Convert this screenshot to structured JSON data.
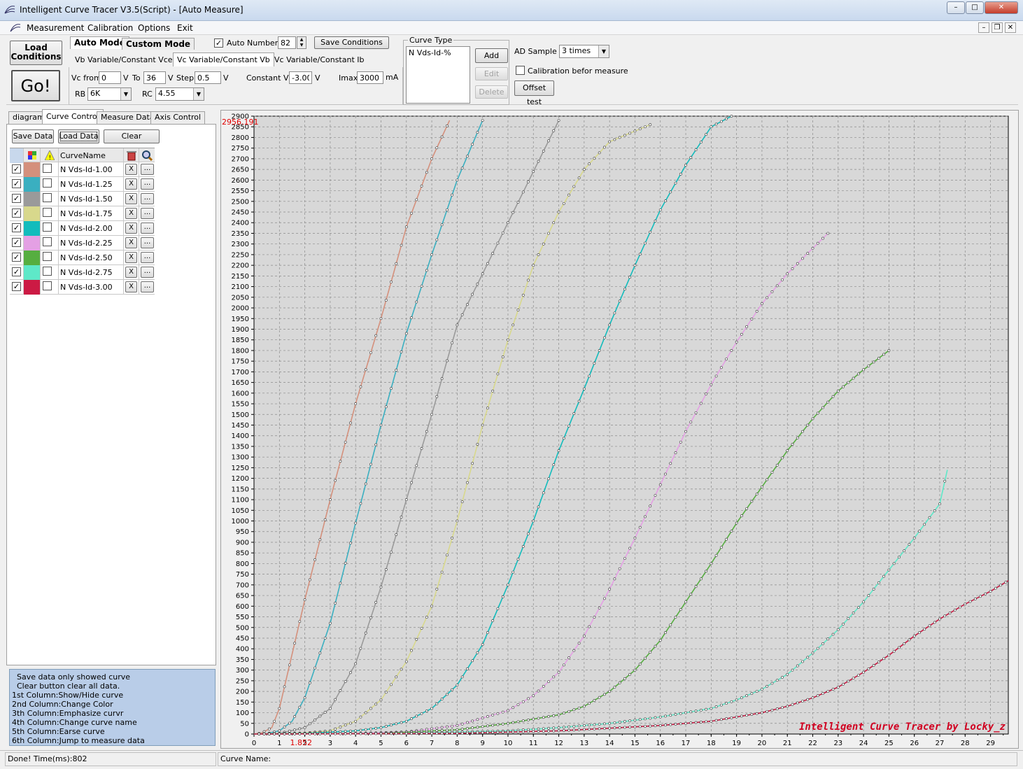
{
  "window": {
    "title": "Intelligent Curve Tracer V3.5(Script) - [Auto Measure]"
  },
  "menu": [
    "Measurement",
    "Calibration",
    "Options",
    "Exit"
  ],
  "toolbar": {
    "load_conditions": "Load Conditions",
    "go": "Go!",
    "auto_mode": "Auto Mode",
    "custom_mode": "Custom Mode",
    "auto_number_label": "Auto Number",
    "auto_number_checked": true,
    "auto_number_value": "82",
    "save_conditions": "Save Conditions",
    "mode_tabs": [
      "Vb Variable/Constant Vce",
      "Vc Variable/Constant Vb",
      "Vc Variable/Constant Ib"
    ],
    "vc_from_label": "Vc from",
    "vc_from": "0",
    "v1": "V",
    "to_label": "To",
    "to": "36",
    "v2": "V",
    "step_label": "Step",
    "step": "0.5",
    "v3": "V",
    "constant_vb_label": "Constant Vb",
    "constant_vb": "-3.00",
    "v4": "V",
    "imax_label": "Imax",
    "imax": "3000",
    "ma": "mA",
    "rb_label": "RB",
    "rb": "6K",
    "rc_label": "RC",
    "rc": "4.55",
    "curve_type_label": "Curve Type",
    "curve_type_item": "N Vds-Id-%",
    "add": "Add",
    "edit": "Edit",
    "delete": "Delete",
    "ad_sample_label": "AD Sample",
    "ad_sample": "3 times",
    "calibration_label": "Calibration befor measure",
    "offset_test": "Offset test"
  },
  "left_tabs": [
    "diagram",
    "Curve Control",
    "Measure Data",
    "Axis Control"
  ],
  "left_buttons": {
    "save_data": "Save Data",
    "load_data": "Load Data",
    "clear": "Clear"
  },
  "curve_table": {
    "header": "CurveName",
    "rows": [
      {
        "name": "N Vds-Id-1.00",
        "color": "#d4907c"
      },
      {
        "name": "N Vds-Id-1.25",
        "color": "#3aafc0"
      },
      {
        "name": "N Vds-Id-1.50",
        "color": "#9a9a9a"
      },
      {
        "name": "N Vds-Id-1.75",
        "color": "#d8d88c"
      },
      {
        "name": "N Vds-Id-2.00",
        "color": "#12bcbc"
      },
      {
        "name": "N Vds-Id-2.25",
        "color": "#e4a0e4"
      },
      {
        "name": "N Vds-Id-2.50",
        "color": "#56ae40"
      },
      {
        "name": "N Vds-Id-2.75",
        "color": "#5ee8c8"
      },
      {
        "name": "N Vds-Id-3.00",
        "color": "#cc1a44"
      }
    ],
    "erase": "X",
    "jump": "..."
  },
  "help_lines": [
    "  Save data only showed curve",
    "  Clear button clear all data.",
    "1st Column:Show/Hide curve",
    "2nd Column:Change Color",
    "3th Column:Emphasize curvr",
    "4th Column:Change curve name",
    "5th Column:Earse curve",
    "6th Column:Jump to measure data"
  ],
  "status": {
    "left": "Done!  Time(ms):802",
    "right": "Curve Name:"
  },
  "chart_data": {
    "type": "line",
    "xlim": [
      0,
      29.7
    ],
    "ylim": [
      0,
      2900
    ],
    "x_ticks": [
      0,
      1,
      2,
      3,
      4,
      5,
      6,
      7,
      8,
      9,
      10,
      11,
      12,
      13,
      14,
      15,
      16,
      17,
      18,
      19,
      20,
      21,
      22,
      23,
      24,
      25,
      26,
      27,
      28,
      29
    ],
    "y_step": 50,
    "grid": true,
    "cursor_y_label": "2956.191",
    "cursor_x_label": "1.852",
    "watermark": "Intelligent Curve Tracer by Locky_z",
    "series": [
      {
        "color": "#d4907c",
        "points": [
          [
            0,
            0
          ],
          [
            0.3,
            5
          ],
          [
            0.7,
            30
          ],
          [
            1,
            120
          ],
          [
            2,
            630
          ],
          [
            3,
            1100
          ],
          [
            4,
            1550
          ],
          [
            5,
            1950
          ],
          [
            6,
            2380
          ],
          [
            7,
            2700
          ],
          [
            7.7,
            2880
          ]
        ]
      },
      {
        "color": "#3aafc0",
        "points": [
          [
            0,
            0
          ],
          [
            0.5,
            2
          ],
          [
            1,
            15
          ],
          [
            1.5,
            60
          ],
          [
            2,
            170
          ],
          [
            3,
            520
          ],
          [
            4,
            990
          ],
          [
            5,
            1450
          ],
          [
            6,
            1880
          ],
          [
            7,
            2250
          ],
          [
            8,
            2600
          ],
          [
            9,
            2880
          ]
        ]
      },
      {
        "color": "#9a9a9a",
        "points": [
          [
            0,
            0
          ],
          [
            1,
            3
          ],
          [
            2,
            30
          ],
          [
            3,
            120
          ],
          [
            4,
            330
          ],
          [
            5,
            690
          ],
          [
            6,
            1100
          ],
          [
            7,
            1500
          ],
          [
            8,
            1920
          ],
          [
            10,
            2400
          ],
          [
            12,
            2880
          ]
        ]
      },
      {
        "color": "#d8d88c",
        "points": [
          [
            0,
            0
          ],
          [
            2,
            5
          ],
          [
            3,
            15
          ],
          [
            4,
            60
          ],
          [
            5,
            160
          ],
          [
            6,
            340
          ],
          [
            7,
            600
          ],
          [
            8,
            1000
          ],
          [
            9,
            1450
          ],
          [
            10,
            1850
          ],
          [
            11,
            2200
          ],
          [
            12,
            2450
          ],
          [
            13,
            2650
          ],
          [
            14,
            2780
          ],
          [
            15.6,
            2860
          ]
        ]
      },
      {
        "color": "#12bcbc",
        "points": [
          [
            0,
            0
          ],
          [
            2,
            3
          ],
          [
            4,
            15
          ],
          [
            5,
            30
          ],
          [
            6,
            60
          ],
          [
            7,
            120
          ],
          [
            8,
            230
          ],
          [
            9,
            420
          ],
          [
            10,
            700
          ],
          [
            11,
            1000
          ],
          [
            12,
            1330
          ],
          [
            13,
            1620
          ],
          [
            14,
            1920
          ],
          [
            15,
            2200
          ],
          [
            16,
            2460
          ],
          [
            17,
            2670
          ],
          [
            18,
            2850
          ],
          [
            18.8,
            2900
          ]
        ]
      },
      {
        "color": "#e4a0e4",
        "points": [
          [
            0,
            0
          ],
          [
            4,
            3
          ],
          [
            6,
            10
          ],
          [
            8,
            40
          ],
          [
            10,
            110
          ],
          [
            11,
            180
          ],
          [
            12,
            290
          ],
          [
            13,
            460
          ],
          [
            14,
            680
          ],
          [
            15,
            920
          ],
          [
            16,
            1170
          ],
          [
            17,
            1420
          ],
          [
            18,
            1640
          ],
          [
            19,
            1840
          ],
          [
            20,
            2020
          ],
          [
            21,
            2160
          ],
          [
            22,
            2280
          ],
          [
            22.6,
            2350
          ]
        ]
      },
      {
        "color": "#56ae40",
        "points": [
          [
            0,
            0
          ],
          [
            5,
            3
          ],
          [
            8,
            20
          ],
          [
            10,
            50
          ],
          [
            12,
            90
          ],
          [
            13,
            130
          ],
          [
            14,
            200
          ],
          [
            15,
            300
          ],
          [
            16,
            440
          ],
          [
            17,
            620
          ],
          [
            18,
            800
          ],
          [
            19,
            990
          ],
          [
            20,
            1160
          ],
          [
            21,
            1330
          ],
          [
            22,
            1480
          ],
          [
            23,
            1610
          ],
          [
            24,
            1710
          ],
          [
            25,
            1800
          ]
        ]
      },
      {
        "color": "#5ee8c8",
        "points": [
          [
            0,
            0
          ],
          [
            6,
            3
          ],
          [
            10,
            15
          ],
          [
            12,
            30
          ],
          [
            14,
            50
          ],
          [
            16,
            80
          ],
          [
            18,
            120
          ],
          [
            19,
            160
          ],
          [
            20,
            210
          ],
          [
            21,
            280
          ],
          [
            22,
            380
          ],
          [
            23,
            490
          ],
          [
            24,
            620
          ],
          [
            25,
            770
          ],
          [
            26,
            920
          ],
          [
            27,
            1080
          ],
          [
            27.3,
            1240
          ]
        ]
      },
      {
        "color": "#cc1a44",
        "points": [
          [
            0,
            0
          ],
          [
            8,
            3
          ],
          [
            12,
            15
          ],
          [
            16,
            40
          ],
          [
            18,
            60
          ],
          [
            20,
            100
          ],
          [
            21,
            130
          ],
          [
            22,
            170
          ],
          [
            23,
            220
          ],
          [
            24,
            290
          ],
          [
            25,
            370
          ],
          [
            26,
            460
          ],
          [
            27,
            540
          ],
          [
            28,
            610
          ],
          [
            29,
            670
          ],
          [
            29.7,
            720
          ]
        ]
      }
    ]
  }
}
